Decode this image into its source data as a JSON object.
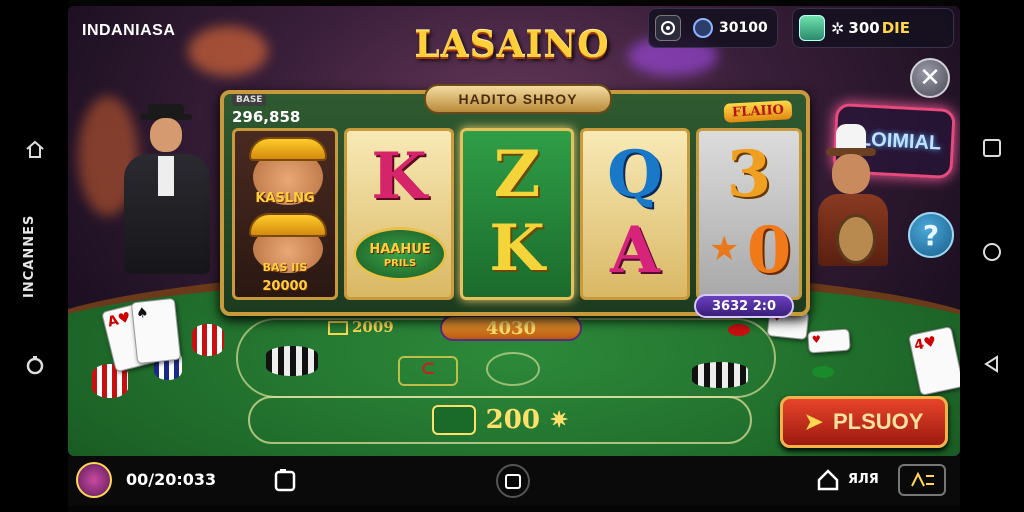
{
  "system_nav": {
    "left_vertical_text": "INCANNES",
    "left_icons": [
      "home-icon",
      "circle-icon"
    ],
    "right_icons": [
      "square-icon",
      "circle-icon",
      "triangle-back-icon"
    ]
  },
  "game": {
    "brand": "INDANIASA",
    "title": "LASAINO",
    "hud": {
      "coins_value": "30100",
      "gems_value": "300",
      "gems_suffix": "DIE"
    },
    "neon_sign": "FLOIMIAL",
    "machine": {
      "banner": "HADITO SHROY",
      "top_left_small": "BASE",
      "top_left_value": "296,858",
      "top_right_badge": "FLAIIO",
      "bottom_pill": "3632 2:0",
      "reel1": {
        "top_text": "KASLNG",
        "bottom_text": "BAS IIS",
        "bottom_value": "20000"
      },
      "reel2": {
        "top_symbol": "K",
        "bottom_text": "HAAHUE",
        "bottom_sub": "PRILS"
      },
      "reel3": {
        "top_symbol": "Z",
        "bottom_symbol": "K"
      },
      "reel4": {
        "top_symbol": "Q",
        "bottom_symbol": "A"
      },
      "reel5": {
        "top_symbol": "3",
        "bottom_symbol": "0"
      }
    },
    "table": {
      "left_amount": "2009",
      "center_pill": "4030",
      "bet_amount": "200"
    },
    "play_button": "PLSUOY"
  },
  "bottom_bar": {
    "balance": "00/20:033",
    "right_value": "ЯЛЯ"
  },
  "colors": {
    "gold": "#ffcf3a",
    "felt": "#1f6a2a",
    "play": "#e8442a"
  }
}
